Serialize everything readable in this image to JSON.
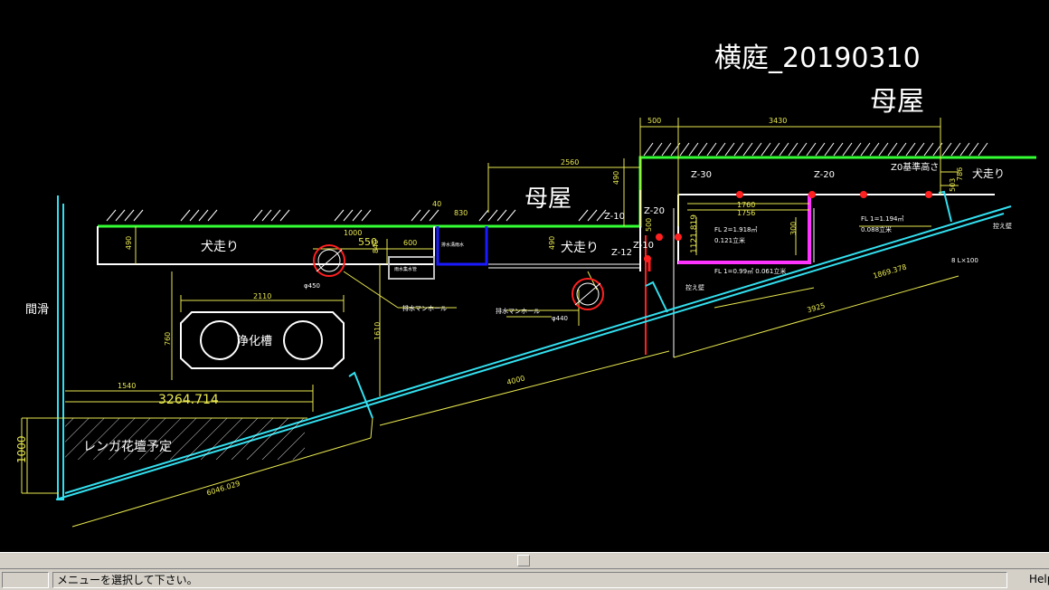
{
  "drawing": {
    "title": "横庭_20190310",
    "main_building": "母屋",
    "main_building_inner": "母屋",
    "dog_run_left": "犬走り",
    "dog_run_mid": "犬走り",
    "dog_run_right": "犬走り",
    "septic_tank": "浄化槽",
    "brick_bed": "レンガ花壇予定",
    "boundary": "間滑",
    "dims": {
      "d500": "500",
      "d3430": "3430",
      "d2560": "2560",
      "d490a": "490",
      "d490b": "490",
      "d490c": "490",
      "d1000a": "1000",
      "d550": "550",
      "d600": "600",
      "d830": "830",
      "d840": "840",
      "d2110": "2110",
      "d760": "760",
      "d1610": "1610",
      "d1540": "1540",
      "d3264": "3264.714",
      "d1000b": "1000",
      "d4000": "4000",
      "d6046": "6046.029",
      "d3925": "3925",
      "d1869": "1869.378",
      "d1760": "1760",
      "d1756": "1756",
      "d300": "300",
      "d819": "1121.819",
      "d40": "40",
      "d503": "503",
      "d786": "786",
      "d500b": "500"
    },
    "labels": {
      "z30": "Z-30",
      "z20a": "Z-20",
      "z20b": "Z-20",
      "z10a": "Z-10",
      "z10b": "Z-10",
      "z12": "Z-12",
      "z_ref": "Z0基準高さ",
      "z_ref_note": "Z0基準高さ",
      "fl_a": "FL 2=1.918㎥",
      "vol_a": "0.121立米",
      "fl_b": "FL 1=1.194㎥",
      "vol_b": "0.088立米",
      "fl_c": "FL 1=0.99㎥ 0.061立米",
      "slope": "8 L×100",
      "retain_a": "控え壁",
      "retain_b": "控え壁",
      "manhole_a": "排水マンホール",
      "manhole_b": "排水マンホール",
      "dia450": "φ450",
      "dia440": "φ440",
      "rainwater": "雨水集水管",
      "drain_pit": "排水溝雨水"
    }
  },
  "statusbar": {
    "message": "メニューを選択して下さい。",
    "help": "Help"
  }
}
